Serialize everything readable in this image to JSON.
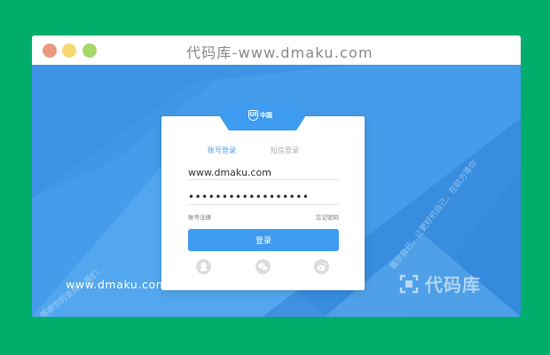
{
  "window": {
    "title": "代码库-www.dmaku.com"
  },
  "login": {
    "badge_text": "中国",
    "badge_logo": "UI",
    "tabs": [
      {
        "label": "账号登录",
        "active": true
      },
      {
        "label": "短信登录",
        "active": false
      }
    ],
    "username": {
      "value": "www.dmaku.com"
    },
    "password": {
      "value": "••••••••••••••••••"
    },
    "register_link": "账号注册",
    "forgot_link": "忘记密码",
    "submit_label": "登录",
    "social_icons": [
      "qq-icon",
      "wechat-icon",
      "weibo-icon"
    ]
  },
  "background": {
    "side_text_left": "感谢你的支持，我们...",
    "side_text_right": "展示自己，让更好的自己，在前方等你",
    "watermark_left": "www.dmaku.com",
    "watermark_right": "代码库"
  },
  "colors": {
    "page_bg": "#00ad6a",
    "viewport_bg": "#3d95e6",
    "accent": "#3d9cf0",
    "tab_active": "#4a9ee8"
  }
}
